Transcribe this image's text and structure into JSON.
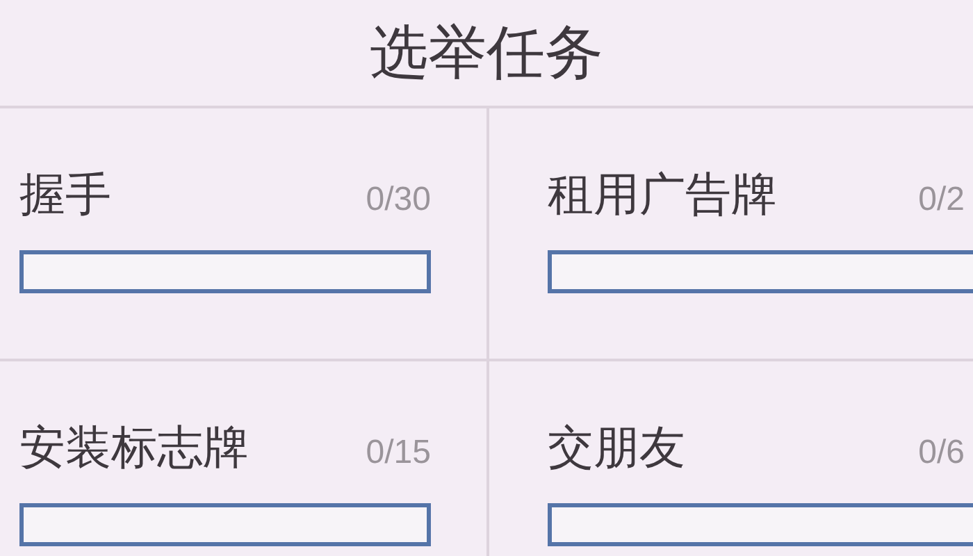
{
  "title": "选举任务",
  "tasks": [
    {
      "name": "握手",
      "count": "0/30",
      "level": 0
    },
    {
      "name": "租用广告牌",
      "count": "0/2",
      "level": 0
    },
    {
      "name": "安装标志牌",
      "count": "0/15",
      "level": 0
    },
    {
      "name": "交朋友",
      "count": "0/6",
      "level": 0
    }
  ]
}
